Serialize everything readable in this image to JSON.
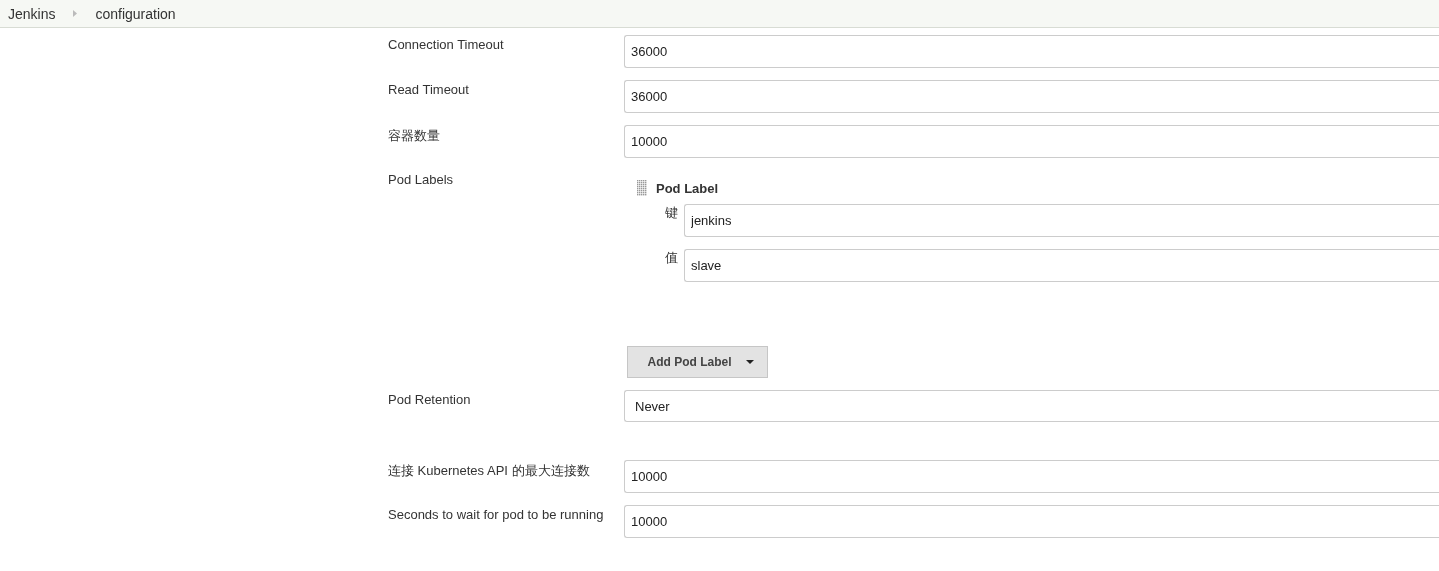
{
  "breadcrumbs": [
    {
      "label": "Jenkins"
    },
    {
      "label": "configuration"
    }
  ],
  "fields": [
    {
      "kind": "text",
      "label": "Connection Timeout",
      "value": "36000"
    },
    {
      "kind": "text",
      "label": "Read Timeout",
      "value": "36000"
    },
    {
      "kind": "text",
      "label": "容器数量",
      "value": "10000"
    },
    {
      "kind": "labels",
      "label": "Pod Labels",
      "entries": [
        {
          "title": "Pod Label",
          "key_label": "键",
          "key": "jenkins",
          "value_label": "值",
          "value": "slave"
        }
      ],
      "add_button": "Add Pod Label"
    },
    {
      "kind": "select",
      "label": "Pod Retention",
      "value": "Never"
    },
    {
      "kind": "text",
      "label": "连接 Kubernetes API 的最大连接数",
      "value": "10000"
    },
    {
      "kind": "text",
      "label": "Seconds to wait for pod to be running",
      "value": "10000"
    }
  ]
}
